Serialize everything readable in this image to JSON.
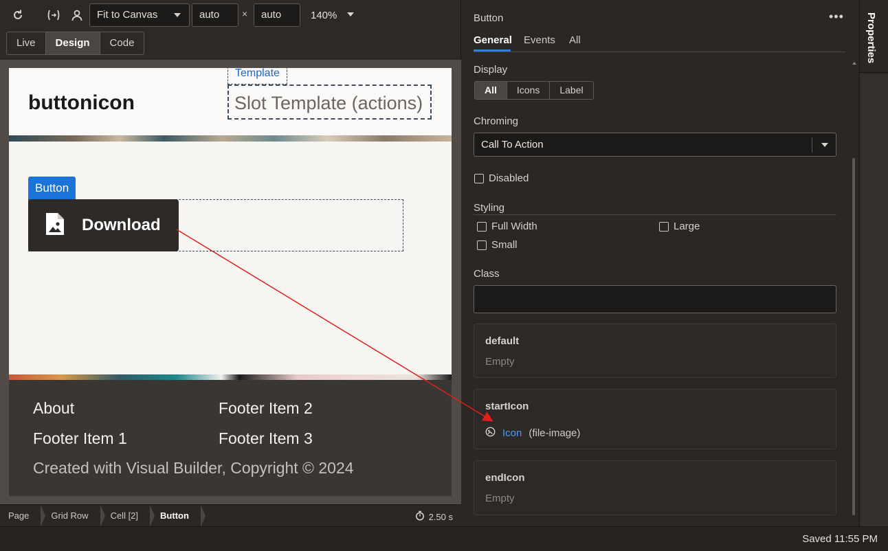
{
  "toolbar": {
    "fit_label": "Fit to Canvas",
    "width_value": "auto",
    "height_value": "auto",
    "times_glyph": "×",
    "zoom": "140%"
  },
  "modes": [
    "Live",
    "Design",
    "Code"
  ],
  "active_mode": "Design",
  "canvas": {
    "app_title": "buttonicon",
    "template_tag": "Template",
    "slot_template": "Slot Template (actions)",
    "button_tag": "Button",
    "download_label": "Download",
    "footer": {
      "about": "About",
      "item1": "Footer Item 1",
      "item2": "Footer Item 2",
      "item3": "Footer Item 3",
      "copyright": "Created with Visual Builder, Copyright © 2024"
    }
  },
  "breadcrumbs": [
    "Page",
    "Grid Row",
    "Cell [2]",
    "Button"
  ],
  "timer": "2.50 s",
  "properties": {
    "title": "Button",
    "tabs": [
      "General",
      "Events",
      "All"
    ],
    "display_label": "Display",
    "display_options": [
      "All",
      "Icons",
      "Label"
    ],
    "chroming_label": "Chroming",
    "chroming_value": "Call To Action",
    "disabled_label": "Disabled",
    "styling_label": "Styling",
    "full_width_label": "Full Width",
    "large_label": "Large",
    "small_label": "Small",
    "class_label": "Class",
    "slots": {
      "default_name": "default",
      "default_value": "Empty",
      "starticon_name": "startIcon",
      "starticon_link": "Icon",
      "starticon_sub": "(file-image)",
      "endicon_name": "endIcon",
      "endicon_value": "Empty"
    }
  },
  "side_tab": "Properties",
  "status": "Saved 11:55 PM",
  "colors": {
    "accent": "#1a73d9",
    "link": "#4b9af5",
    "annotation_arrow": "#e0201b"
  }
}
